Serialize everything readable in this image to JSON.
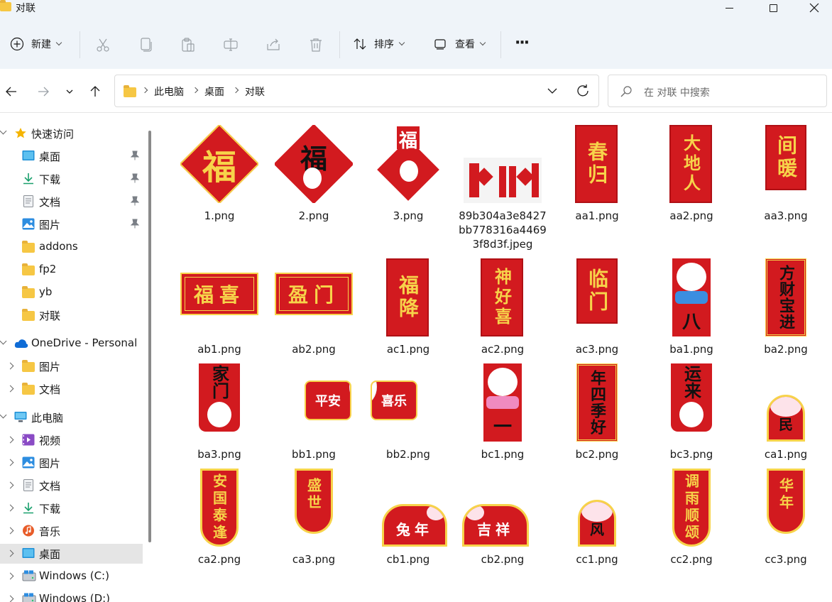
{
  "window": {
    "title": "对联",
    "controls": [
      "minimize",
      "maximize",
      "close"
    ]
  },
  "toolbar": {
    "new_label": "新建",
    "sort_label": "排序",
    "view_label": "查看",
    "more_label": "···",
    "disabled_actions": [
      "cut-icon",
      "copy-icon",
      "paste-icon",
      "rename-icon",
      "share-icon",
      "delete-icon"
    ]
  },
  "address": {
    "segments": [
      "此电脑",
      "桌面",
      "对联"
    ]
  },
  "search": {
    "placeholder": "在 对联 中搜索"
  },
  "sidebar": {
    "items": [
      {
        "label": "快速访问",
        "icon": "star-icon",
        "expand": "open",
        "indent": 0
      },
      {
        "label": "桌面",
        "icon": "desktop-icon",
        "pinned": true,
        "indent": 1
      },
      {
        "label": "下载",
        "icon": "download-icon",
        "pinned": true,
        "indent": 1
      },
      {
        "label": "文档",
        "icon": "document-icon",
        "pinned": true,
        "indent": 1
      },
      {
        "label": "图片",
        "icon": "pictures-icon",
        "pinned": true,
        "indent": 1
      },
      {
        "label": "addons",
        "icon": "folder-icon",
        "indent": 1
      },
      {
        "label": "fp2",
        "icon": "folder-icon",
        "indent": 1
      },
      {
        "label": "yb",
        "icon": "folder-icon",
        "indent": 1
      },
      {
        "label": "对联",
        "icon": "folder-icon",
        "indent": 1
      },
      {
        "label": "OneDrive - Personal",
        "icon": "cloud-icon",
        "expand": "open",
        "indent": 0
      },
      {
        "label": "图片",
        "icon": "folder-icon",
        "expand": "closed",
        "indent": 1
      },
      {
        "label": "文档",
        "icon": "folder-icon",
        "expand": "closed",
        "indent": 1
      },
      {
        "label": "此电脑",
        "icon": "computer-icon",
        "expand": "open",
        "indent": 0
      },
      {
        "label": "视频",
        "icon": "video-icon",
        "expand": "closed",
        "indent": 1
      },
      {
        "label": "图片",
        "icon": "pictures-icon",
        "expand": "closed",
        "indent": 1
      },
      {
        "label": "文档",
        "icon": "document-icon",
        "expand": "closed",
        "indent": 1
      },
      {
        "label": "下载",
        "icon": "download-icon",
        "expand": "closed",
        "indent": 1
      },
      {
        "label": "音乐",
        "icon": "music-icon",
        "expand": "closed",
        "indent": 1
      },
      {
        "label": "桌面",
        "icon": "desktop-icon",
        "expand": "closed",
        "indent": 1,
        "selected": true
      },
      {
        "label": "Windows (C:)",
        "icon": "drive-icon",
        "expand": "closed",
        "indent": 1
      },
      {
        "label": "Windows (D:)",
        "icon": "drive-icon",
        "expand": "closed",
        "indent": 1
      }
    ]
  },
  "files": [
    {
      "name": "1.png",
      "art": "diamond",
      "text": "福"
    },
    {
      "name": "2.png",
      "art": "diamond-bunny",
      "text": "福"
    },
    {
      "name": "3.png",
      "art": "bunny-card",
      "text": "福"
    },
    {
      "name": "89b304a3e8427bb778316a44693f8d3f.jpeg",
      "art": "banner-set",
      "text": ""
    },
    {
      "name": "aa1.png",
      "art": "vertical",
      "text": "春归"
    },
    {
      "name": "aa2.png",
      "art": "vertical",
      "text": "大地人"
    },
    {
      "name": "aa3.png",
      "art": "vertical-short",
      "text": "间暖"
    },
    {
      "name": "ab1.png",
      "art": "horizontal",
      "text": "福喜"
    },
    {
      "name": "ab2.png",
      "art": "horizontal",
      "text": "盈门"
    },
    {
      "name": "ac1.png",
      "art": "vertical",
      "text": "福降"
    },
    {
      "name": "ac2.png",
      "art": "vertical",
      "text": "神好喜"
    },
    {
      "name": "ac3.png",
      "art": "vertical-short",
      "text": "临门"
    },
    {
      "name": "ba1.png",
      "art": "bunny-vertical",
      "text": "八"
    },
    {
      "name": "ba2.png",
      "art": "vertical-black",
      "text": "方财宝进"
    },
    {
      "name": "ba3.png",
      "art": "bunny-vertical-black",
      "text": "家门"
    },
    {
      "name": "bb1.png",
      "art": "bunny-horizontal",
      "text": "平安"
    },
    {
      "name": "bb2.png",
      "art": "bunny-horizontal",
      "text": "喜乐"
    },
    {
      "name": "bc1.png",
      "art": "bunny-vertical",
      "text": "一"
    },
    {
      "name": "bc2.png",
      "art": "vertical-black",
      "text": "年四季好"
    },
    {
      "name": "bc3.png",
      "art": "bunny-vertical-black",
      "text": "运来"
    },
    {
      "name": "ca1.png",
      "art": "arch-bunny",
      "text": "民"
    },
    {
      "name": "ca2.png",
      "art": "arch",
      "text": "安国泰逢"
    },
    {
      "name": "ca3.png",
      "art": "arch-short",
      "text": "盛世"
    },
    {
      "name": "cb1.png",
      "art": "arch-horizontal",
      "text": "兔年"
    },
    {
      "name": "cb2.png",
      "art": "arch-horizontal",
      "text": "吉祥"
    },
    {
      "name": "cc1.png",
      "art": "arch-bunny",
      "text": "风"
    },
    {
      "name": "cc2.png",
      "art": "arch",
      "text": "调雨顺颂"
    },
    {
      "name": "cc3.png",
      "art": "arch-short",
      "text": "华年"
    }
  ],
  "colors": {
    "chrome_bg": "#eff4f9",
    "couplet_red": "#d21a1f",
    "couplet_gold": "#f7d34a",
    "selection": "#e5e5e5"
  }
}
